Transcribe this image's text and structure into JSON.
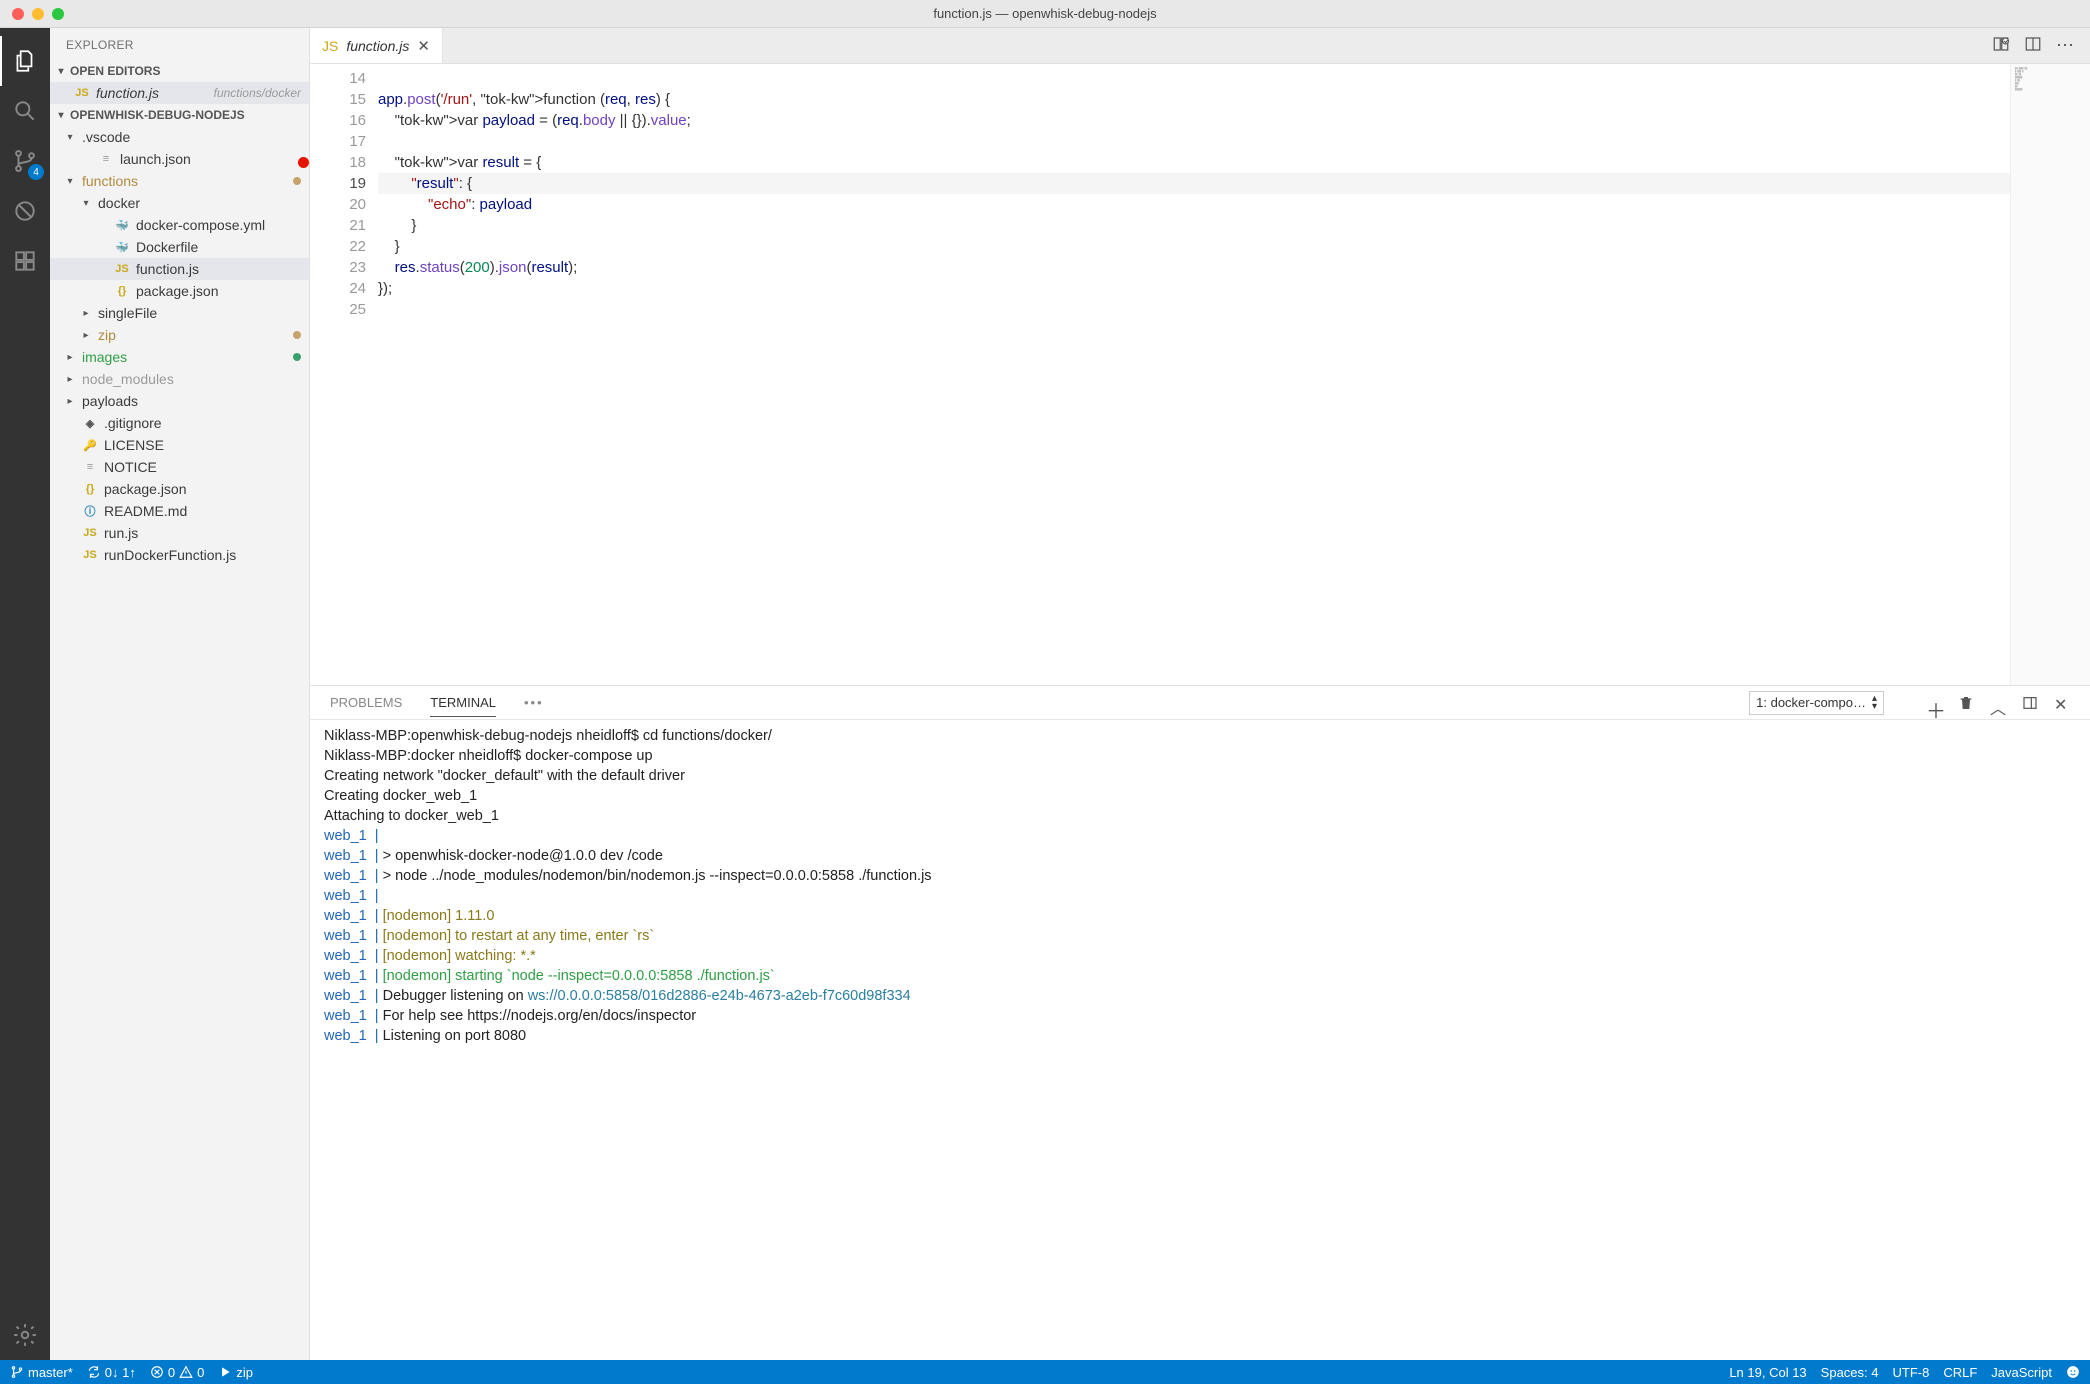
{
  "window": {
    "title": "function.js — openwhisk-debug-nodejs"
  },
  "activitybar": {
    "explorer": "Explorer",
    "search": "Search",
    "scm": "Source Control",
    "scm_badge": "4",
    "debug": "Debug",
    "extensions": "Extensions",
    "settings": "Settings"
  },
  "sidebar": {
    "title": "EXPLORER",
    "open_editors_label": "OPEN EDITORS",
    "open_editors": [
      {
        "icon": "JS",
        "name": "function.js",
        "hint": "functions/docker"
      }
    ],
    "workspace_label": "OPENWHISK-DEBUG-NODEJS",
    "tree": [
      {
        "depth": 0,
        "twisty": "▾",
        "icon": "",
        "name": ".vscode"
      },
      {
        "depth": 1,
        "twisty": "",
        "icon": "≡",
        "icoClass": "ico-text",
        "name": "launch.json"
      },
      {
        "depth": 0,
        "twisty": "▾",
        "icon": "",
        "name": "functions",
        "nameClass": "name-mod",
        "dot": "dot-modified"
      },
      {
        "depth": 1,
        "twisty": "▾",
        "icon": "",
        "name": "docker"
      },
      {
        "depth": 2,
        "twisty": "",
        "icon": "🐳",
        "icoClass": "ico-docker",
        "name": "docker-compose.yml"
      },
      {
        "depth": 2,
        "twisty": "",
        "icon": "🐳",
        "icoClass": "ico-docker",
        "name": "Dockerfile"
      },
      {
        "depth": 2,
        "twisty": "",
        "icon": "JS",
        "icoClass": "ico-js",
        "name": "function.js",
        "selected": true
      },
      {
        "depth": 2,
        "twisty": "",
        "icon": "{}",
        "icoClass": "ico-json",
        "name": "package.json"
      },
      {
        "depth": 1,
        "twisty": "▸",
        "icon": "",
        "name": "singleFile"
      },
      {
        "depth": 1,
        "twisty": "▸",
        "icon": "",
        "name": "zip",
        "nameClass": "name-mod",
        "dot": "dot-modified"
      },
      {
        "depth": 0,
        "twisty": "▸",
        "icon": "",
        "name": "images",
        "nameClass": "name-unt",
        "dot": "dot-untracked"
      },
      {
        "depth": 0,
        "twisty": "▸",
        "icon": "",
        "name": "node_modules",
        "nameClass": "",
        "muted": true
      },
      {
        "depth": 0,
        "twisty": "▸",
        "icon": "",
        "name": "payloads"
      },
      {
        "depth": 0,
        "twisty": "",
        "icon": "◈",
        "icoClass": "ico-git",
        "name": ".gitignore"
      },
      {
        "depth": 0,
        "twisty": "",
        "icon": "🔑",
        "icoClass": "ico-key",
        "name": "LICENSE"
      },
      {
        "depth": 0,
        "twisty": "",
        "icon": "≡",
        "icoClass": "ico-text",
        "name": "NOTICE"
      },
      {
        "depth": 0,
        "twisty": "",
        "icon": "{}",
        "icoClass": "ico-json",
        "name": "package.json"
      },
      {
        "depth": 0,
        "twisty": "",
        "icon": "ⓘ",
        "icoClass": "ico-info",
        "name": "README.md"
      },
      {
        "depth": 0,
        "twisty": "",
        "icon": "JS",
        "icoClass": "ico-js",
        "name": "run.js"
      },
      {
        "depth": 0,
        "twisty": "",
        "icon": "JS",
        "icoClass": "ico-js",
        "name": "runDockerFunction.js"
      }
    ]
  },
  "tab": {
    "icon": "JS",
    "label": "function.js"
  },
  "editor_actions": {
    "more": "⋯"
  },
  "code": {
    "first_line_no": 14,
    "current_line": 19,
    "breakpoint_line": 18,
    "lines": [
      "",
      "app.post('/run', function (req, res) {",
      "    var payload = (req.body || {}).value;",
      "",
      "    var result = {",
      "        \"result\": {",
      "            \"echo\": payload",
      "        }",
      "    }",
      "    res.status(200).json(result);",
      "});",
      ""
    ]
  },
  "panel": {
    "tabs": {
      "problems": "PROBLEMS",
      "terminal": "TERMINAL",
      "more": "•••"
    },
    "terminal_picker": "1: docker-compo…",
    "actions": {
      "new": "+",
      "kill": "🗑",
      "up": "︿",
      "split": "▥",
      "close": "✕"
    },
    "terminal_lines": [
      {
        "segs": [
          {
            "t": "Niklass-MBP:openwhisk-debug-nodejs nheidloff$ cd functions/docker/"
          }
        ]
      },
      {
        "segs": [
          {
            "t": "Niklass-MBP:docker nheidloff$ docker-compose up"
          }
        ]
      },
      {
        "segs": [
          {
            "t": "Creating network \"docker_default\" with the default driver"
          }
        ]
      },
      {
        "segs": [
          {
            "t": "Creating docker_web_1"
          }
        ]
      },
      {
        "segs": [
          {
            "t": "Attaching to docker_web_1"
          }
        ]
      },
      {
        "segs": [
          {
            "t": "web_1  | ",
            "c": "t-blue"
          }
        ]
      },
      {
        "segs": [
          {
            "t": "web_1  | ",
            "c": "t-blue"
          },
          {
            "t": "> openwhisk-docker-node@1.0.0 dev /code"
          }
        ]
      },
      {
        "segs": [
          {
            "t": "web_1  | ",
            "c": "t-blue"
          },
          {
            "t": "> node ../node_modules/nodemon/bin/nodemon.js --inspect=0.0.0.0:5858 ./function.js"
          }
        ]
      },
      {
        "segs": [
          {
            "t": "web_1  | ",
            "c": "t-blue"
          }
        ]
      },
      {
        "segs": [
          {
            "t": "web_1  | ",
            "c": "t-blue"
          },
          {
            "t": "[nodemon] ",
            "c": "t-olive"
          },
          {
            "t": "1.11.0",
            "c": "t-olive"
          }
        ]
      },
      {
        "segs": [
          {
            "t": "web_1  | ",
            "c": "t-blue"
          },
          {
            "t": "[nodemon] ",
            "c": "t-olive"
          },
          {
            "t": "to restart at any time, enter `rs`",
            "c": "t-olive"
          }
        ]
      },
      {
        "segs": [
          {
            "t": "web_1  | ",
            "c": "t-blue"
          },
          {
            "t": "[nodemon] ",
            "c": "t-olive"
          },
          {
            "t": "watching: *.*",
            "c": "t-olive"
          }
        ]
      },
      {
        "segs": [
          {
            "t": "web_1  | ",
            "c": "t-blue"
          },
          {
            "t": "[nodemon] ",
            "c": "t-green"
          },
          {
            "t": "starting `node --inspect=0.0.0.0:5858 ./function.js`",
            "c": "t-green"
          }
        ]
      },
      {
        "segs": [
          {
            "t": "web_1  | ",
            "c": "t-blue"
          },
          {
            "t": "Debugger listening on "
          },
          {
            "t": "ws://0.0.0.0:5858/016d2886-e24b-4673-a2eb-f7c60d98f334",
            "c": "t-cyan"
          }
        ]
      },
      {
        "segs": [
          {
            "t": "web_1  | ",
            "c": "t-blue"
          },
          {
            "t": "For help see https://nodejs.org/en/docs/inspector"
          }
        ]
      },
      {
        "segs": [
          {
            "t": "web_1  | ",
            "c": "t-blue"
          },
          {
            "t": "Listening on port 8080"
          }
        ]
      }
    ]
  },
  "statusbar": {
    "branch": "master*",
    "sync": "0↓ 1↑",
    "errors": "0",
    "warnings": "0",
    "launch": "zip",
    "cursor": "Ln 19, Col 13",
    "spaces": "Spaces: 4",
    "encoding": "UTF-8",
    "eol": "CRLF",
    "lang": "JavaScript"
  }
}
